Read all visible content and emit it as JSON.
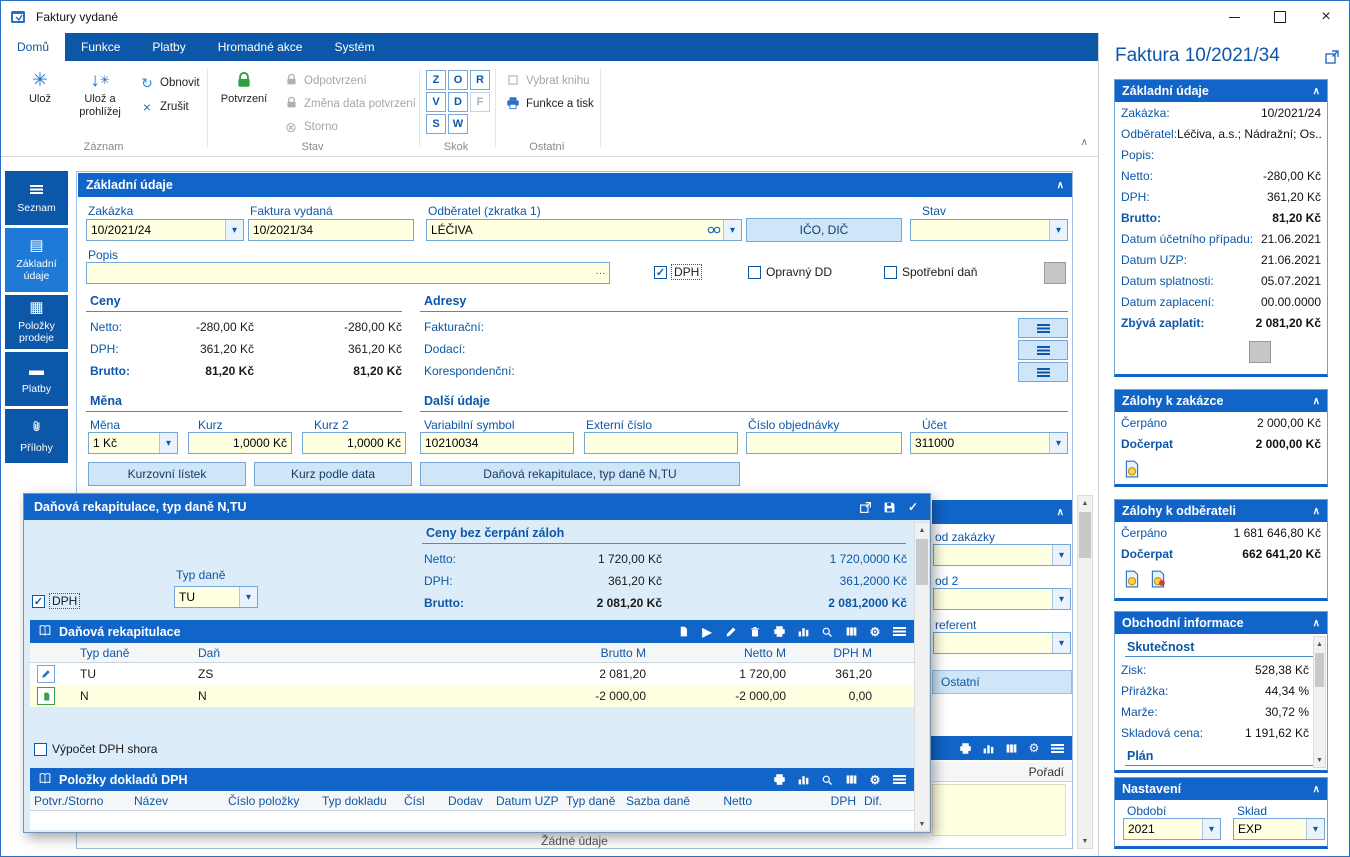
{
  "icons": {
    "close": "×",
    "dropdown": "▾",
    "collapse": "∧",
    "check": "✓",
    "ellipsis": "···",
    "refresh": "↻",
    "cancel": "×",
    "storno": "⊗",
    "save_star": "✳",
    "arrow_down": "↓",
    "play": "▶",
    "gear": "⚙",
    "up": "▲",
    "down": "▼",
    "form_tile": "▤",
    "grid_tile": "▦",
    "card_tile": "▬"
  },
  "titlebar": {
    "title": "Faktury vydané"
  },
  "ribbon": {
    "tabs": [
      {
        "label": "Domů"
      },
      {
        "label": "Funkce"
      },
      {
        "label": "Platby"
      },
      {
        "label": "Hromadné akce"
      },
      {
        "label": "Systém"
      }
    ],
    "zaznam_label": "Záznam",
    "uloz": "Ulož",
    "uloz_a_prohlizej": "Ulož a prohlížej",
    "obnovit": "Obnovit",
    "zrusit": "Zrušit",
    "stav_label": "Stav",
    "potvrzeni": "Potvrzení",
    "odpotvrzeni": "Odpotvrzení",
    "zmena_data_potvrzeni": "Změna data potvrzení",
    "storno": "Storno",
    "skok_label": "Skok",
    "skok_letters": [
      "Z",
      "O",
      "R",
      "V",
      "D",
      "F",
      "S",
      "W"
    ],
    "ostatni_label": "Ostatní",
    "vybrat_knihu": "Vybrat knihu",
    "funkce_a_tisk": "Funkce a tisk"
  },
  "sidebar": {
    "items": [
      {
        "label": "Seznam"
      },
      {
        "label": "Základní údaje"
      },
      {
        "label": "Položky prodeje"
      },
      {
        "label": "Platby"
      },
      {
        "label": "Přílohy"
      }
    ]
  },
  "form": {
    "title": "Základní údaje",
    "zakazka_label": "Zakázka",
    "zakazka_value": "10/2021/24",
    "faktura_label": "Faktura vydaná",
    "faktura_value": "10/2021/34",
    "odberatel_label": "Odběratel (zkratka 1)",
    "odberatel_value": "LÉČIVA",
    "ico_dic": "IČO, DIČ",
    "stav_label": "Stav",
    "stav_value": "",
    "popis_label": "Popis",
    "popis_value": "",
    "chk_dph": "DPH",
    "chk_opravny": "Opravný DD",
    "chk_spotrebni": "Spotřební daň",
    "ceny": {
      "title": "Ceny",
      "netto_label": "Netto:",
      "netto_v1": "-280,00 Kč",
      "netto_v2": "-280,00 Kč",
      "dph_label": "DPH:",
      "dph_v1": "361,20 Kč",
      "dph_v2": "361,20 Kč",
      "brutto_label": "Brutto:",
      "brutto_v1": "81,20 Kč",
      "brutto_v2": "81,20 Kč"
    },
    "adresy": {
      "title": "Adresy",
      "fakturacni": "Fakturační:",
      "dodaci": "Dodací:",
      "korespondencni": "Korespondenční:"
    },
    "mena": {
      "title": "Měna",
      "mena_label": "Měna",
      "mena_value": "1 Kč",
      "kurz_label": "Kurz",
      "kurz_value": "1,0000 Kč",
      "kurz2_label": "Kurz 2",
      "kurz2_value": "1,0000 Kč",
      "btn_kurzovni": "Kurzovní lístek",
      "btn_kurz_data": "Kurz podle data"
    },
    "dalsi": {
      "title": "Další údaje",
      "vs_label": "Variabilní symbol",
      "vs_value": "10210034",
      "ext_label": "Externí číslo",
      "ext_value": "",
      "obj_label": "Číslo objednávky",
      "obj_value": "",
      "ucet_label": "Účet",
      "ucet_value": "311000",
      "btn_rekap": "Daňová rekapitulace, typ daně N,TU"
    },
    "hidden": {
      "od_zakazky": "od zakázky",
      "od2": "od 2",
      "referent": "referent",
      "ostatni_tab": "Ostatní",
      "poradi": "Pořadí"
    },
    "empty_text": "Žádné údaje"
  },
  "dialog": {
    "title": "Daňová rekapitulace, typ daně N,TU",
    "ceny_title": "Ceny bez čerpání záloh",
    "netto_label": "Netto:",
    "netto_v1": "1 720,00 Kč",
    "netto_v2": "1 720,0000 Kč",
    "dph_label": "DPH:",
    "dph_v1": "361,20 Kč",
    "dph_v2": "361,2000 Kč",
    "brutto_label": "Brutto:",
    "brutto_v1": "2 081,20 Kč",
    "brutto_v2": "2 081,2000 Kč",
    "chk_dph": "DPH",
    "typ_dane_label": "Typ daně",
    "typ_dane_value": "TU",
    "rekap": {
      "title": "Daňová rekapitulace",
      "col_typ": "Typ daně",
      "col_dan": "Daň",
      "col_brutto": "Brutto M",
      "col_netto": "Netto M",
      "col_dph": "DPH M",
      "rows": [
        {
          "typ": "TU",
          "dan": "ZS",
          "brutto": "2 081,20",
          "netto": "1 720,00",
          "dph": "361,20"
        },
        {
          "typ": "N",
          "dan": "N",
          "brutto": "-2 000,00",
          "netto": "-2 000,00",
          "dph": "0,00"
        }
      ]
    },
    "chk_vypocet": "Výpočet DPH shora",
    "polozky": {
      "title": "Položky dokladů DPH",
      "columns": [
        "Potvr./Storno",
        "Název",
        "Číslo položky",
        "Typ dokladu",
        "Čísl",
        "Dodav",
        "Datum UZP",
        "Typ daně",
        "Sazba daně",
        "Netto",
        "DPH",
        "Dif."
      ]
    }
  },
  "info": {
    "title": "Faktura 10/2021/34",
    "zakladni": {
      "title": "Základní údaje",
      "rows": [
        {
          "l": "Zakázka:",
          "v": "10/2021/24"
        },
        {
          "l": "Odběratel:",
          "v": "Léčiva, a.s.; Nádražní; Os..."
        },
        {
          "l": "Popis:",
          "v": ""
        },
        {
          "l": "Netto:",
          "v": "-280,00 Kč"
        },
        {
          "l": "DPH:",
          "v": "361,20 Kč"
        },
        {
          "l": "Brutto:",
          "v": "81,20 Kč"
        },
        {
          "l": "Datum účetního případu:",
          "v": "21.06.2021"
        },
        {
          "l": "Datum UZP:",
          "v": "21.06.2021"
        },
        {
          "l": "Datum splatnosti:",
          "v": "05.07.2021"
        },
        {
          "l": "Datum zaplacení:",
          "v": "00.00.0000"
        },
        {
          "l": "Zbývá zaplatit:",
          "v": "2 081,20 Kč"
        }
      ]
    },
    "zalohy_zakazce": {
      "title": "Zálohy k zakázce",
      "cerpano_l": "Čerpáno",
      "cerpano_v": "2 000,00 Kč",
      "docerpat_l": "Dočerpat",
      "docerpat_v": "2 000,00 Kč"
    },
    "zalohy_odberateli": {
      "title": "Zálohy k odběrateli",
      "cerpano_l": "Čerpáno",
      "cerpano_v": "1 681 646,80 Kč",
      "docerpat_l": "Dočerpat",
      "docerpat_v": "662 641,20 Kč"
    },
    "obchodni": {
      "title": "Obchodní informace",
      "skutecnost": "Skutečnost",
      "rows": [
        {
          "l": "Zisk:",
          "v": "528,38 Kč"
        },
        {
          "l": "Přirážka:",
          "v": "44,34 %"
        },
        {
          "l": "Marže:",
          "v": "30,72 %"
        },
        {
          "l": "Skladová cena:",
          "v": "1 191,62 Kč"
        }
      ],
      "plan": "Plán"
    },
    "nastaveni": {
      "title": "Nastavení",
      "obdobi_l": "Období",
      "obdobi_v": "2021",
      "sklad_l": "Sklad",
      "sklad_v": "EXP"
    }
  }
}
